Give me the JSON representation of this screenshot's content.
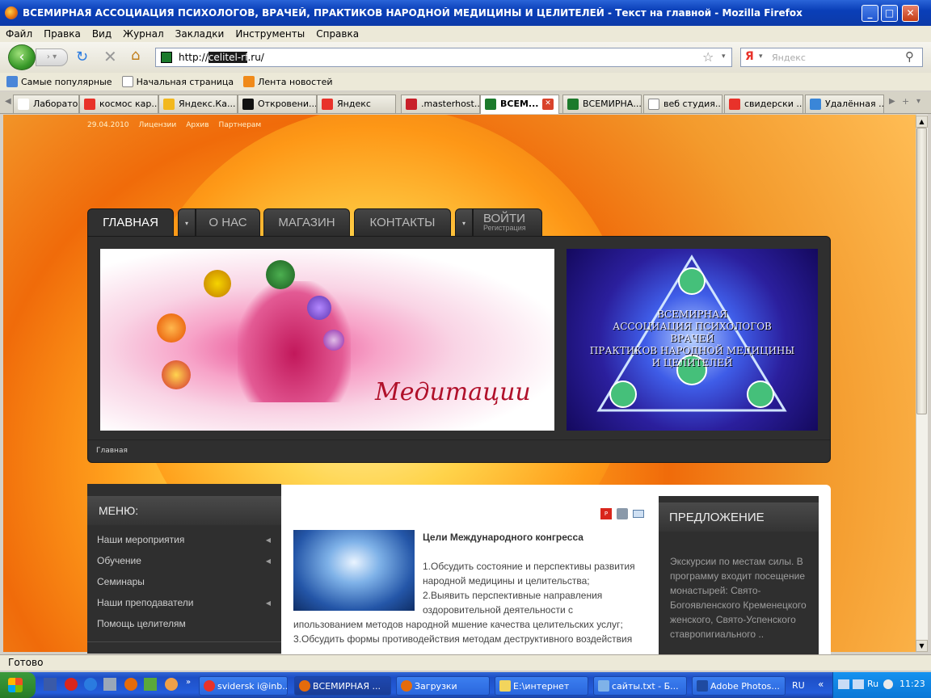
{
  "window": {
    "title": "ВСЕМИРНАЯ АССОЦИАЦИЯ ПСИХОЛОГОВ, ВРАЧЕЙ, ПРАКТИКОВ НАРОДНОЙ МЕДИЦИНЫ И ЦЕЛИТЕЛЕЙ - Текст на главной - Mozilla Firefox"
  },
  "menu": [
    "Файл",
    "Правка",
    "Вид",
    "Журнал",
    "Закладки",
    "Инструменты",
    "Справка"
  ],
  "address": {
    "scheme": "http://",
    "host_selected": "celitel-rf",
    "suffix": ".ru/",
    "search_placeholder": "Яндекс",
    "search_logo": "Я"
  },
  "bookmarks": [
    "Самые популярные",
    "Начальная страница",
    "Лента новостей"
  ],
  "tabs": [
    {
      "label": "Лаборатор...",
      "color": "#ffffff"
    },
    {
      "label": "космос кар...",
      "color": "#e8322a"
    },
    {
      "label": "Яндекс.Ка...",
      "color": "#f2b81e"
    },
    {
      "label": "Откровени...",
      "color": "#111111"
    },
    {
      "label": "Яндекс",
      "color": "#e8322a"
    },
    {
      "label": ".masterhost...",
      "color": "#c8202a"
    },
    {
      "label": "ВСЕМ...",
      "color": "#1c7a2c"
    },
    {
      "label": "ВСЕМИРНА...",
      "color": "#1c7a2c"
    },
    {
      "label": "веб студия...",
      "color": "#ffffff"
    },
    {
      "label": "свидерски ...",
      "color": "#e8322a"
    },
    {
      "label": "Удалённая ...",
      "color": "#3a86d8"
    }
  ],
  "page": {
    "toplinks": [
      "29.04.2010",
      "Лицензии",
      "Архив",
      "Партнерам"
    ],
    "nav": {
      "home": "ГЛАВНАЯ",
      "about": "О НАС",
      "shop": "МАГАЗИН",
      "contacts": "КОНТАКТЫ",
      "login": "ВОЙТИ",
      "register": "Регистрация"
    },
    "banner1_text": "Медитации",
    "banner2_text": [
      "ВСЕМИРНАЯ",
      "АССОЦИАЦИЯ ПСИХОЛОГОВ",
      "ВРАЧЕЙ",
      "ПРАКТИКОВ НАРОДНОЙ МЕДИЦИНЫ",
      "И ЦЕЛИТЕЛЕЙ"
    ],
    "breadcrumb": "Главная",
    "menu_title": "МЕНЮ:",
    "menu_items": [
      "Наши мероприятия",
      "Обучение",
      "Семинары",
      "Наши преподаватели",
      "Помощь целителям"
    ],
    "article": {
      "title": "Цели Международного конгресса",
      "lines": [
        "1.Обсудить состояние и перспективы развития",
        "народной медицины и целительства;",
        "2.Выявить перспективные направления",
        "оздоровительной деятельности с",
        "ипользованием методов народной мшение качества целительских услуг;",
        "3.Обсудить формы противодействия методам деструктивного воздействия"
      ]
    },
    "offer": {
      "title": "ПРЕДЛОЖЕНИЕ",
      "text": "Экскурсии по местам силы. В программу входит посещение монастырей: Свято-Богоявленского Кременецкого женского, Свято-Успенского ставропигиального .."
    }
  },
  "status": "Готово",
  "taskbar": [
    {
      "label": "svidersk i@inb...",
      "color": "#e8322a"
    },
    {
      "label": "ВСЕМИРНАЯ ...",
      "color": "#e56b0b"
    },
    {
      "label": "Загрузки",
      "color": "#e56b0b"
    },
    {
      "label": "E:\\интернет",
      "color": "#f2d45c"
    },
    {
      "label": "сайты.txt - Б...",
      "color": "#7fb2e8"
    },
    {
      "label": "Adobe Photos...",
      "color": "#1f4aa0"
    }
  ],
  "tray": {
    "lang": "RU",
    "lang2": "Ru",
    "time": "11:23"
  }
}
